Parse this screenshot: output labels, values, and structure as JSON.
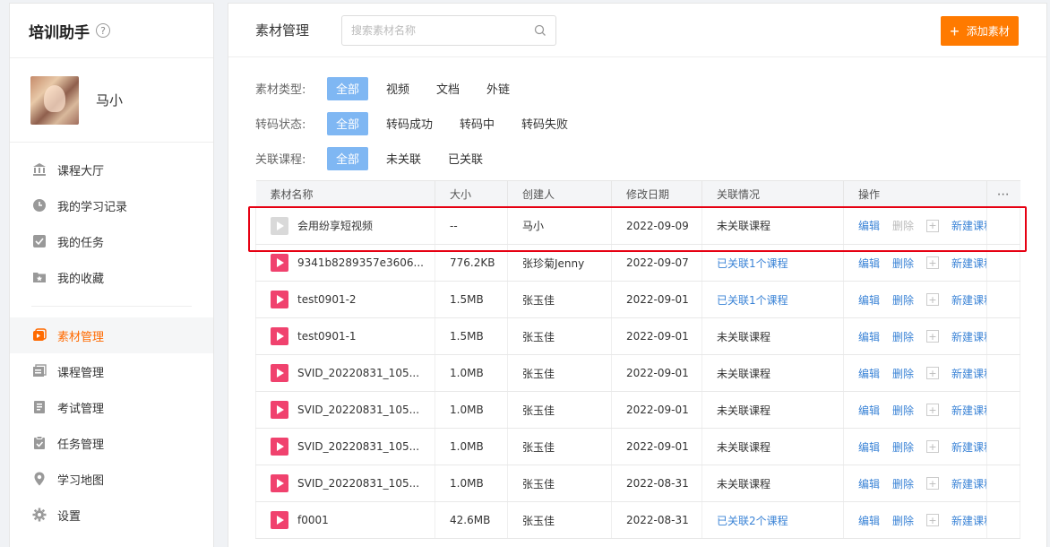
{
  "app": {
    "title": "培训助手",
    "help_icon": "?"
  },
  "user": {
    "name": "马小"
  },
  "sidebar": {
    "items": [
      {
        "label": "课程大厅",
        "icon": "bank-icon",
        "active": false
      },
      {
        "label": "我的学习记录",
        "icon": "clock-icon",
        "active": false
      },
      {
        "label": "我的任务",
        "icon": "checkbox-icon",
        "active": false
      },
      {
        "label": "我的收藏",
        "icon": "star-folder-icon",
        "active": false
      },
      {
        "label": "素材管理",
        "icon": "media-icon",
        "active": true
      },
      {
        "label": "课程管理",
        "icon": "course-icon",
        "active": false
      },
      {
        "label": "考试管理",
        "icon": "exam-icon",
        "active": false
      },
      {
        "label": "任务管理",
        "icon": "task-icon",
        "active": false
      },
      {
        "label": "学习地图",
        "icon": "map-pin-icon",
        "active": false
      },
      {
        "label": "设置",
        "icon": "gear-icon",
        "active": false
      }
    ]
  },
  "header": {
    "title": "素材管理",
    "search_placeholder": "搜索素材名称",
    "add_button": "添加素材"
  },
  "filters": {
    "type": {
      "label": "素材类型:",
      "options": [
        "全部",
        "视频",
        "文档",
        "外链"
      ],
      "selected": 0
    },
    "transcode": {
      "label": "转码状态:",
      "options": [
        "全部",
        "转码成功",
        "转码中",
        "转码失败"
      ],
      "selected": 0
    },
    "course": {
      "label": "关联课程:",
      "options": [
        "全部",
        "未关联",
        "已关联"
      ],
      "selected": 0
    }
  },
  "table": {
    "columns": [
      "素材名称",
      "大小",
      "创建人",
      "修改日期",
      "关联情况",
      "操作",
      "⋯"
    ],
    "ops": {
      "edit": "编辑",
      "delete": "删除",
      "new_course": "新建课程"
    },
    "rows": [
      {
        "name": "会用纷享短视频",
        "size": "--",
        "creator": "马小",
        "date": "2022-09-09",
        "relation": "未关联课程",
        "related": false,
        "grey": true
      },
      {
        "name": "9341b8289357e3606...",
        "size": "776.2KB",
        "creator": "张珍菊Jenny",
        "date": "2022-09-07",
        "relation": "已关联1个课程",
        "related": true,
        "grey": false
      },
      {
        "name": "test0901-2",
        "size": "1.5MB",
        "creator": "张玉佳",
        "date": "2022-09-01",
        "relation": "已关联1个课程",
        "related": true,
        "grey": false
      },
      {
        "name": "test0901-1",
        "size": "1.5MB",
        "creator": "张玉佳",
        "date": "2022-09-01",
        "relation": "未关联课程",
        "related": false,
        "grey": false
      },
      {
        "name": "SVID_20220831_105...",
        "size": "1.0MB",
        "creator": "张玉佳",
        "date": "2022-09-01",
        "relation": "未关联课程",
        "related": false,
        "grey": false
      },
      {
        "name": "SVID_20220831_105...",
        "size": "1.0MB",
        "creator": "张玉佳",
        "date": "2022-09-01",
        "relation": "未关联课程",
        "related": false,
        "grey": false
      },
      {
        "name": "SVID_20220831_105...",
        "size": "1.0MB",
        "creator": "张玉佳",
        "date": "2022-09-01",
        "relation": "未关联课程",
        "related": false,
        "grey": false
      },
      {
        "name": "SVID_20220831_105...",
        "size": "1.0MB",
        "creator": "张玉佳",
        "date": "2022-08-31",
        "relation": "未关联课程",
        "related": false,
        "grey": false
      },
      {
        "name": "f0001",
        "size": "42.6MB",
        "creator": "张玉佳",
        "date": "2022-08-31",
        "relation": "已关联2个课程",
        "related": true,
        "grey": false
      }
    ]
  },
  "colors": {
    "accent": "#ff7a00",
    "chip_active": "#7fb7f3",
    "link": "#3a83d6",
    "play": "#f0426e",
    "highlight": "#e60012"
  }
}
